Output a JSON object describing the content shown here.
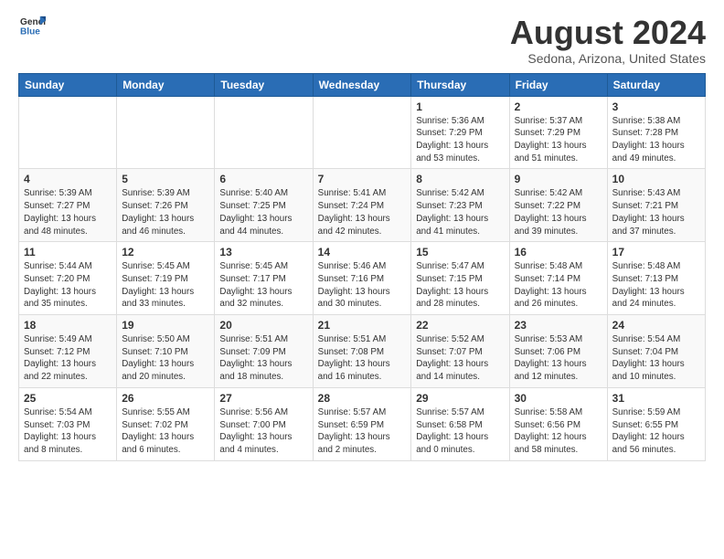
{
  "header": {
    "logo_line1": "General",
    "logo_line2": "Blue",
    "month_title": "August 2024",
    "location": "Sedona, Arizona, United States"
  },
  "weekdays": [
    "Sunday",
    "Monday",
    "Tuesday",
    "Wednesday",
    "Thursday",
    "Friday",
    "Saturday"
  ],
  "weeks": [
    [
      {
        "day": "",
        "sunrise": "",
        "sunset": "",
        "daylight": ""
      },
      {
        "day": "",
        "sunrise": "",
        "sunset": "",
        "daylight": ""
      },
      {
        "day": "",
        "sunrise": "",
        "sunset": "",
        "daylight": ""
      },
      {
        "day": "",
        "sunrise": "",
        "sunset": "",
        "daylight": ""
      },
      {
        "day": "1",
        "sunrise": "Sunrise: 5:36 AM",
        "sunset": "Sunset: 7:29 PM",
        "daylight": "Daylight: 13 hours and 53 minutes."
      },
      {
        "day": "2",
        "sunrise": "Sunrise: 5:37 AM",
        "sunset": "Sunset: 7:29 PM",
        "daylight": "Daylight: 13 hours and 51 minutes."
      },
      {
        "day": "3",
        "sunrise": "Sunrise: 5:38 AM",
        "sunset": "Sunset: 7:28 PM",
        "daylight": "Daylight: 13 hours and 49 minutes."
      }
    ],
    [
      {
        "day": "4",
        "sunrise": "Sunrise: 5:39 AM",
        "sunset": "Sunset: 7:27 PM",
        "daylight": "Daylight: 13 hours and 48 minutes."
      },
      {
        "day": "5",
        "sunrise": "Sunrise: 5:39 AM",
        "sunset": "Sunset: 7:26 PM",
        "daylight": "Daylight: 13 hours and 46 minutes."
      },
      {
        "day": "6",
        "sunrise": "Sunrise: 5:40 AM",
        "sunset": "Sunset: 7:25 PM",
        "daylight": "Daylight: 13 hours and 44 minutes."
      },
      {
        "day": "7",
        "sunrise": "Sunrise: 5:41 AM",
        "sunset": "Sunset: 7:24 PM",
        "daylight": "Daylight: 13 hours and 42 minutes."
      },
      {
        "day": "8",
        "sunrise": "Sunrise: 5:42 AM",
        "sunset": "Sunset: 7:23 PM",
        "daylight": "Daylight: 13 hours and 41 minutes."
      },
      {
        "day": "9",
        "sunrise": "Sunrise: 5:42 AM",
        "sunset": "Sunset: 7:22 PM",
        "daylight": "Daylight: 13 hours and 39 minutes."
      },
      {
        "day": "10",
        "sunrise": "Sunrise: 5:43 AM",
        "sunset": "Sunset: 7:21 PM",
        "daylight": "Daylight: 13 hours and 37 minutes."
      }
    ],
    [
      {
        "day": "11",
        "sunrise": "Sunrise: 5:44 AM",
        "sunset": "Sunset: 7:20 PM",
        "daylight": "Daylight: 13 hours and 35 minutes."
      },
      {
        "day": "12",
        "sunrise": "Sunrise: 5:45 AM",
        "sunset": "Sunset: 7:19 PM",
        "daylight": "Daylight: 13 hours and 33 minutes."
      },
      {
        "day": "13",
        "sunrise": "Sunrise: 5:45 AM",
        "sunset": "Sunset: 7:17 PM",
        "daylight": "Daylight: 13 hours and 32 minutes."
      },
      {
        "day": "14",
        "sunrise": "Sunrise: 5:46 AM",
        "sunset": "Sunset: 7:16 PM",
        "daylight": "Daylight: 13 hours and 30 minutes."
      },
      {
        "day": "15",
        "sunrise": "Sunrise: 5:47 AM",
        "sunset": "Sunset: 7:15 PM",
        "daylight": "Daylight: 13 hours and 28 minutes."
      },
      {
        "day": "16",
        "sunrise": "Sunrise: 5:48 AM",
        "sunset": "Sunset: 7:14 PM",
        "daylight": "Daylight: 13 hours and 26 minutes."
      },
      {
        "day": "17",
        "sunrise": "Sunrise: 5:48 AM",
        "sunset": "Sunset: 7:13 PM",
        "daylight": "Daylight: 13 hours and 24 minutes."
      }
    ],
    [
      {
        "day": "18",
        "sunrise": "Sunrise: 5:49 AM",
        "sunset": "Sunset: 7:12 PM",
        "daylight": "Daylight: 13 hours and 22 minutes."
      },
      {
        "day": "19",
        "sunrise": "Sunrise: 5:50 AM",
        "sunset": "Sunset: 7:10 PM",
        "daylight": "Daylight: 13 hours and 20 minutes."
      },
      {
        "day": "20",
        "sunrise": "Sunrise: 5:51 AM",
        "sunset": "Sunset: 7:09 PM",
        "daylight": "Daylight: 13 hours and 18 minutes."
      },
      {
        "day": "21",
        "sunrise": "Sunrise: 5:51 AM",
        "sunset": "Sunset: 7:08 PM",
        "daylight": "Daylight: 13 hours and 16 minutes."
      },
      {
        "day": "22",
        "sunrise": "Sunrise: 5:52 AM",
        "sunset": "Sunset: 7:07 PM",
        "daylight": "Daylight: 13 hours and 14 minutes."
      },
      {
        "day": "23",
        "sunrise": "Sunrise: 5:53 AM",
        "sunset": "Sunset: 7:06 PM",
        "daylight": "Daylight: 13 hours and 12 minutes."
      },
      {
        "day": "24",
        "sunrise": "Sunrise: 5:54 AM",
        "sunset": "Sunset: 7:04 PM",
        "daylight": "Daylight: 13 hours and 10 minutes."
      }
    ],
    [
      {
        "day": "25",
        "sunrise": "Sunrise: 5:54 AM",
        "sunset": "Sunset: 7:03 PM",
        "daylight": "Daylight: 13 hours and 8 minutes."
      },
      {
        "day": "26",
        "sunrise": "Sunrise: 5:55 AM",
        "sunset": "Sunset: 7:02 PM",
        "daylight": "Daylight: 13 hours and 6 minutes."
      },
      {
        "day": "27",
        "sunrise": "Sunrise: 5:56 AM",
        "sunset": "Sunset: 7:00 PM",
        "daylight": "Daylight: 13 hours and 4 minutes."
      },
      {
        "day": "28",
        "sunrise": "Sunrise: 5:57 AM",
        "sunset": "Sunset: 6:59 PM",
        "daylight": "Daylight: 13 hours and 2 minutes."
      },
      {
        "day": "29",
        "sunrise": "Sunrise: 5:57 AM",
        "sunset": "Sunset: 6:58 PM",
        "daylight": "Daylight: 13 hours and 0 minutes."
      },
      {
        "day": "30",
        "sunrise": "Sunrise: 5:58 AM",
        "sunset": "Sunset: 6:56 PM",
        "daylight": "Daylight: 12 hours and 58 minutes."
      },
      {
        "day": "31",
        "sunrise": "Sunrise: 5:59 AM",
        "sunset": "Sunset: 6:55 PM",
        "daylight": "Daylight: 12 hours and 56 minutes."
      }
    ]
  ]
}
